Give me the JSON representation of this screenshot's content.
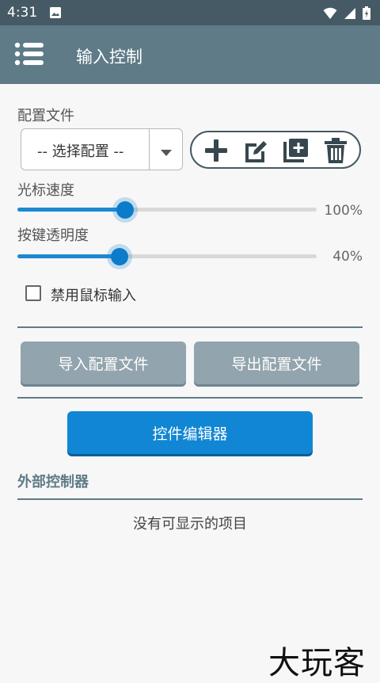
{
  "status_bar": {
    "time": "4:31",
    "icons": [
      "image-icon",
      "wifi-icon",
      "signal-icon",
      "battery-icon"
    ]
  },
  "app_bar": {
    "title": "输入控制",
    "menu_icon": "menu-icon"
  },
  "profile": {
    "label": "配置文件",
    "select_value": "-- 选择配置 --",
    "actions": [
      "add-icon",
      "edit-icon",
      "copy-icon",
      "delete-icon"
    ]
  },
  "cursor_speed": {
    "label": "光标速度",
    "value_text": "100%",
    "level": 0.36
  },
  "button_opacity": {
    "label": "按键透明度",
    "value_text": "40%",
    "level": 0.34
  },
  "disable_mouse": {
    "label": "禁用鼠标输入",
    "checked": false
  },
  "buttons": {
    "import": "导入配置文件",
    "export": "导出配置文件",
    "editor": "控件编辑器"
  },
  "external": {
    "title": "外部控制器",
    "empty_text": "没有可显示的项目"
  },
  "watermark": "大玩客",
  "colors": {
    "status_bar": "#455a64",
    "app_bar": "#5e7b87",
    "accent": "#1186d4",
    "gray_button": "#92a4ad"
  }
}
